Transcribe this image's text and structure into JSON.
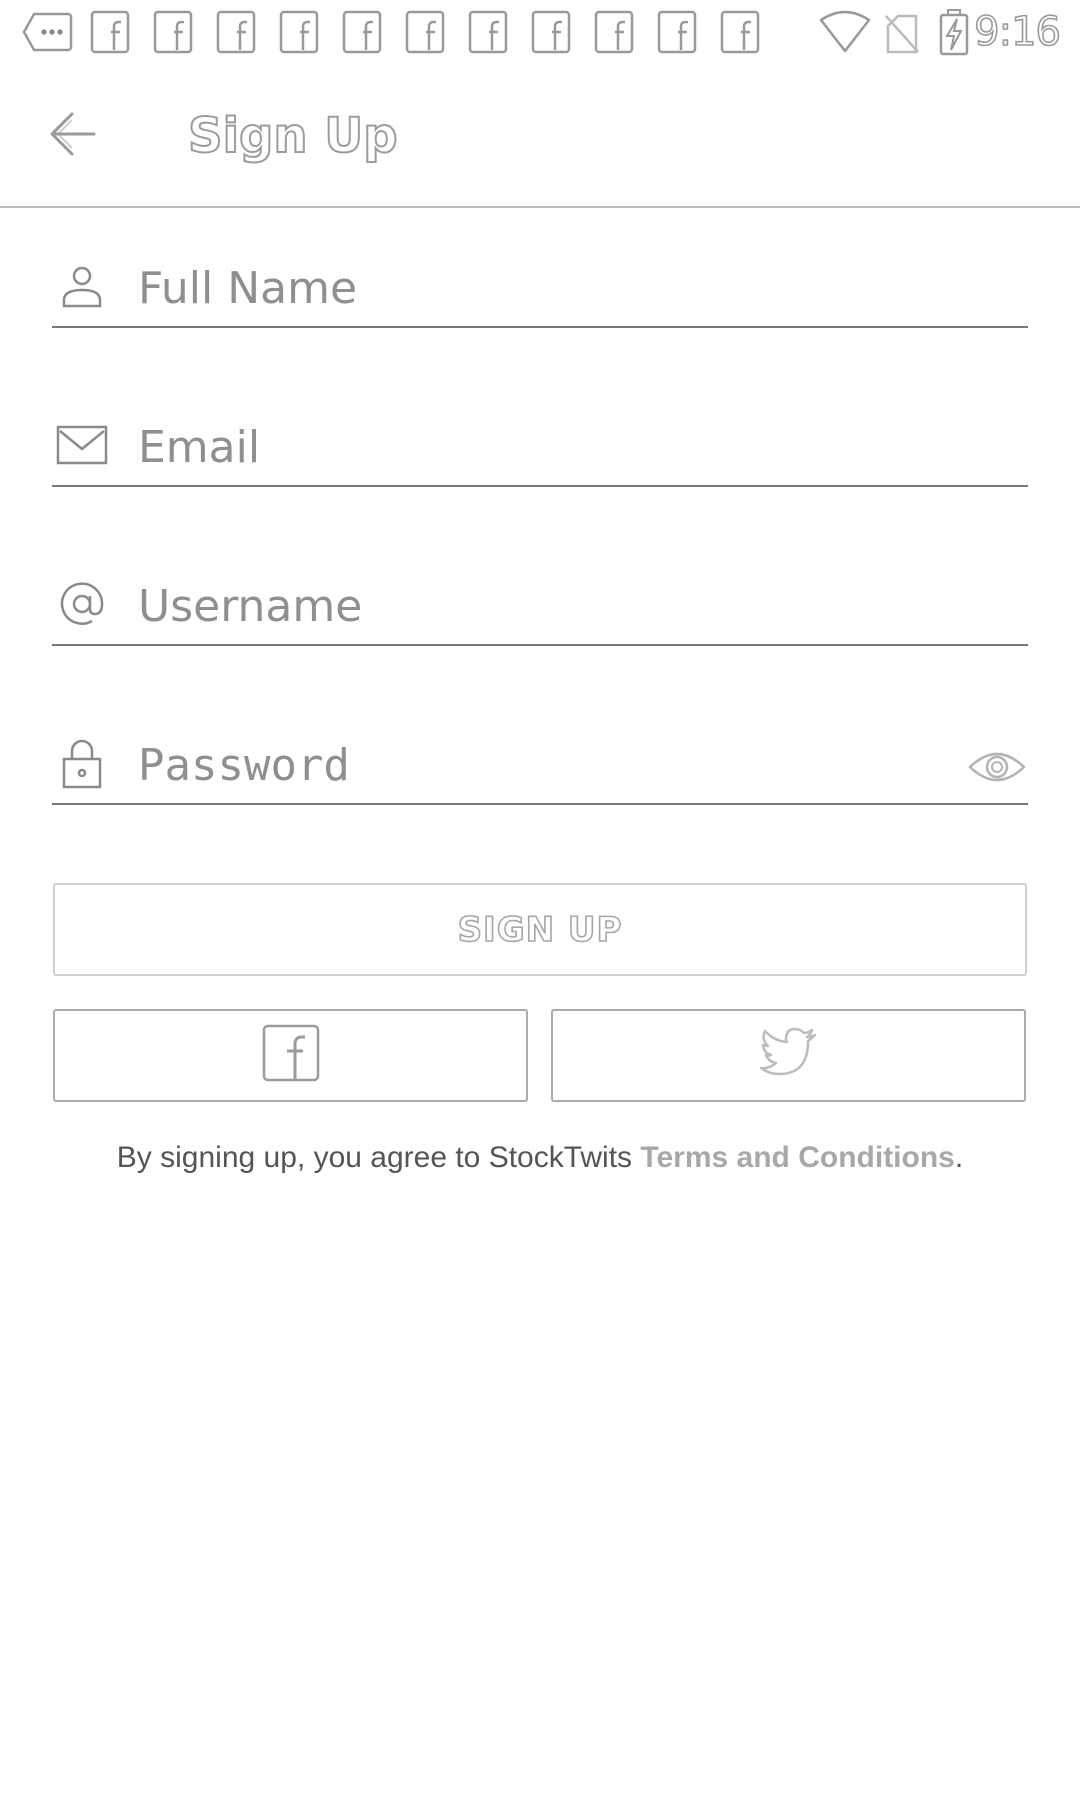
{
  "status_bar": {
    "time": "9:16",
    "notification_icons": [
      "more-notifications-icon",
      "facebook-icon",
      "facebook-icon",
      "facebook-icon",
      "facebook-icon",
      "facebook-icon",
      "facebook-icon",
      "facebook-icon",
      "facebook-icon",
      "facebook-icon",
      "facebook-icon",
      "facebook-icon"
    ],
    "system_icons": [
      "wifi-icon",
      "no-sim-icon",
      "battery-charging-icon"
    ]
  },
  "app_bar": {
    "back_icon": "arrow-left-icon",
    "title": "Sign Up"
  },
  "form": {
    "full_name": {
      "icon": "person-icon",
      "placeholder": "Full Name",
      "value": ""
    },
    "email": {
      "icon": "envelope-icon",
      "placeholder": "Email",
      "value": ""
    },
    "username": {
      "icon": "at-sign-icon",
      "placeholder": "Username",
      "value": ""
    },
    "password": {
      "icon": "lock-icon",
      "placeholder": "Password",
      "value": "",
      "toggle_icon": "eye-icon"
    }
  },
  "buttons": {
    "sign_up_label": "SIGN UP",
    "facebook_icon": "facebook-icon",
    "twitter_icon": "twitter-bird-icon"
  },
  "terms": {
    "prefix": "By signing up, you agree to StockTwits ",
    "link_text": "Terms and Conditions",
    "suffix": "."
  }
}
